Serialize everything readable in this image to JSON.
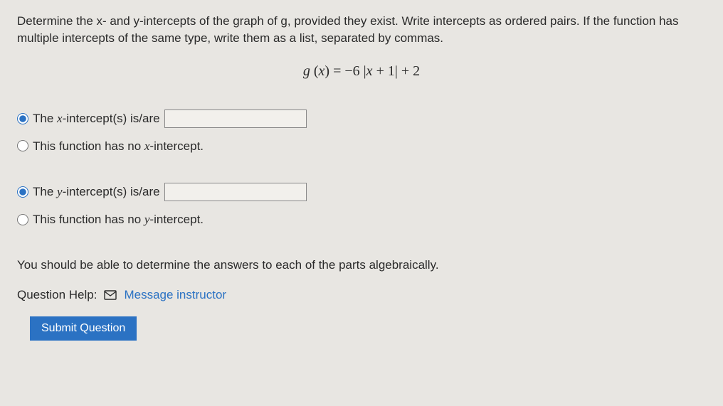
{
  "prompt": "Determine the x- and y-intercepts of the graph of g, provided they exist. Write intercepts as ordered pairs. If the function has multiple intercepts of the same type, write them as a list, separated by commas.",
  "equation": "g (x) = −6 |x + 1| + 2",
  "x_group": {
    "has_label_prefix": "The ",
    "has_label_var": "x",
    "has_label_suffix": "-intercept(s) is/are",
    "value": "",
    "none_prefix": "This function has no ",
    "none_var": "x",
    "none_suffix": "-intercept."
  },
  "y_group": {
    "has_label_prefix": "The ",
    "has_label_var": "y",
    "has_label_suffix": "-intercept(s) is/are",
    "value": "",
    "none_prefix": "This function has no ",
    "none_var": "y",
    "none_suffix": "-intercept."
  },
  "help_note": "You should be able to determine the answers to each of the parts algebraically.",
  "qhelp_label": "Question Help:",
  "msg_link": "Message instructor",
  "submit_label": "Submit Question"
}
